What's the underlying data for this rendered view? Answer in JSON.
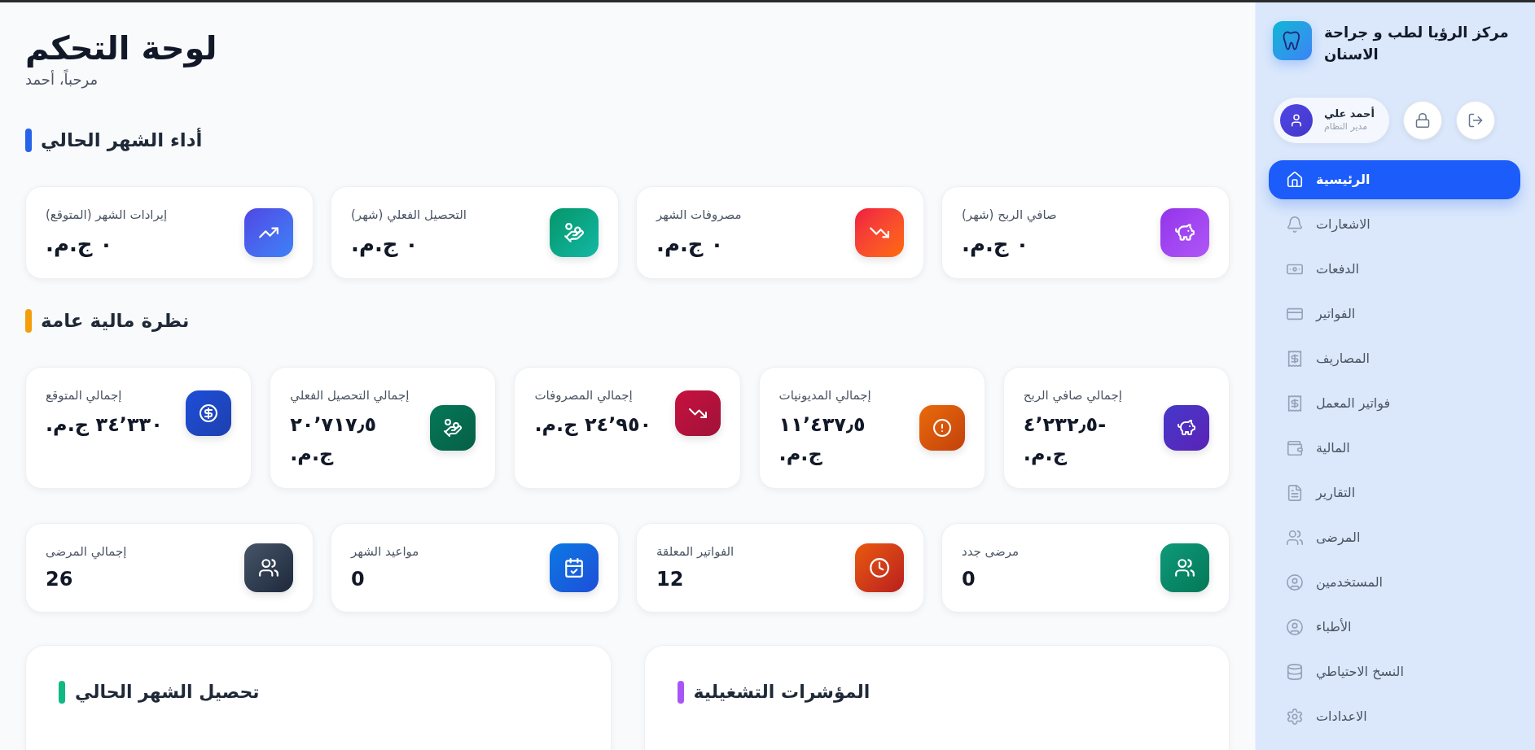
{
  "sidebar": {
    "clinic_name": "مركز الرؤيا لطب و جراحة الاسنان",
    "user": {
      "name": "أحمد علي",
      "role": "مدير النظام"
    },
    "nav_items": [
      {
        "label": "الرئيسية",
        "selected": true
      },
      {
        "label": "الاشعارات",
        "selected": false
      },
      {
        "label": "الدفعات",
        "selected": false
      },
      {
        "label": "الفواتير",
        "selected": false
      },
      {
        "label": "المصاريف",
        "selected": false
      },
      {
        "label": "فواتير المعمل",
        "selected": false
      },
      {
        "label": "المالية",
        "selected": false
      },
      {
        "label": "التقارير",
        "selected": false
      },
      {
        "label": "المرضى",
        "selected": false
      },
      {
        "label": "المستخدمين",
        "selected": false
      },
      {
        "label": "الأطباء",
        "selected": false
      },
      {
        "label": "النسخ الاحتياطي",
        "selected": false
      },
      {
        "label": "الاعدادات",
        "selected": false
      }
    ]
  },
  "header": {
    "title": "لوحة التحكم",
    "greeting": "مرحباً، أحمد"
  },
  "current_month": {
    "heading": "أداء الشهر الحالي",
    "cards": [
      {
        "label": "صافي الربح (شهر)",
        "value": "٠ ج.م."
      },
      {
        "label": "مصروفات الشهر",
        "value": "٠ ج.م."
      },
      {
        "label": "التحصيل الفعلي (شهر)",
        "value": "٠ ج.م."
      },
      {
        "label": "إيرادات الشهر (المتوقع)",
        "value": "٠ ج.م."
      }
    ]
  },
  "financial_overview": {
    "heading": "نظرة مالية عامة",
    "cards": [
      {
        "label": "إجمالي صافي الربح",
        "value": "-٤٬٢٣٢٫٥ ج.م."
      },
      {
        "label": "إجمالي المديونيات",
        "value": "١١٬٤٣٧٫٥ ج.م."
      },
      {
        "label": "إجمالي المصروفات",
        "value": "٢٤٬٩٥٠ ج.م."
      },
      {
        "label": "إجمالي التحصيل الفعلي",
        "value": "٢٠٬٧١٧٫٥ ج.م."
      },
      {
        "label": "إجمالي المتوقع",
        "value": "٣٤٬٣٣٠ ج.م."
      }
    ]
  },
  "counters": {
    "cards": [
      {
        "label": "مرضى جدد",
        "value": "0"
      },
      {
        "label": "الفواتير المعلقة",
        "value": "12"
      },
      {
        "label": "مواعيد الشهر",
        "value": "0"
      },
      {
        "label": "إجمالي المرضى",
        "value": "26"
      }
    ]
  },
  "panels": [
    {
      "heading": "المؤشرات التشغيلية"
    },
    {
      "heading": "تحصيل الشهر الحالي"
    }
  ]
}
